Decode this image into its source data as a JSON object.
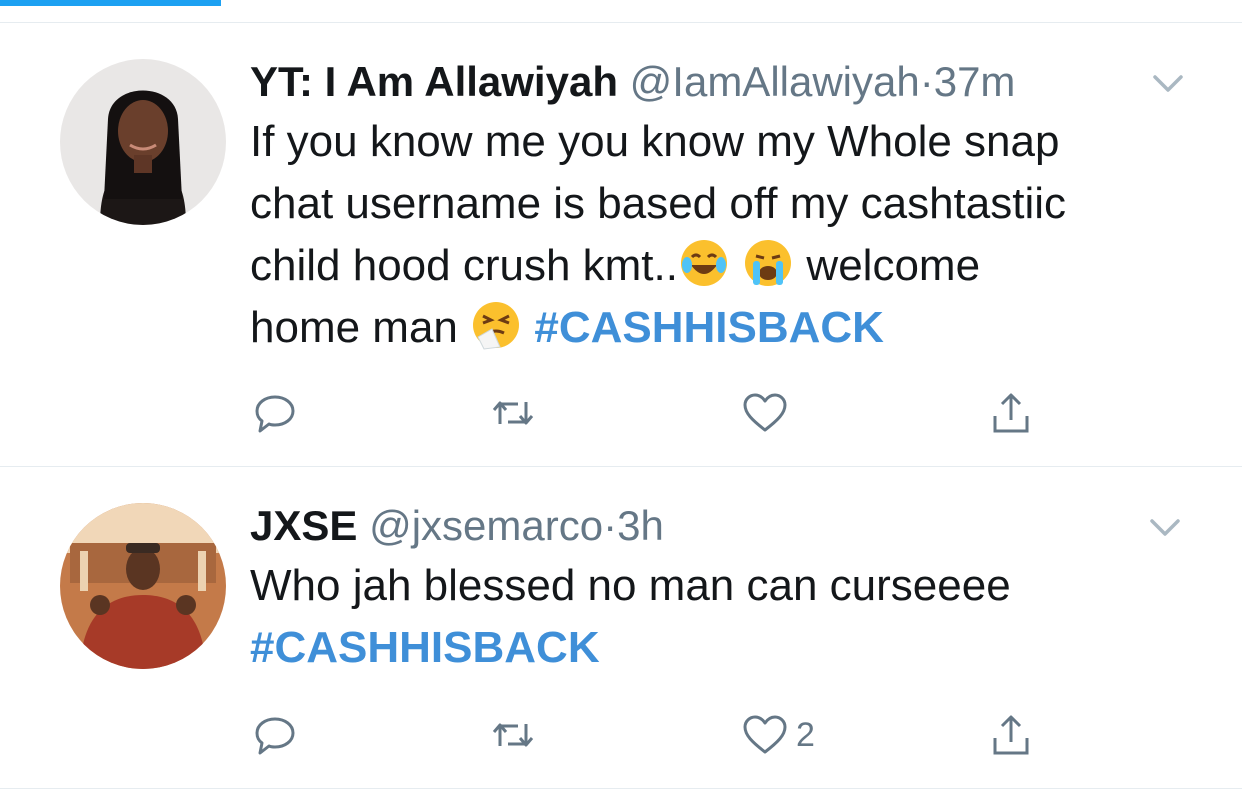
{
  "tweets": [
    {
      "name": "YT: I Am Allawiyah",
      "handle": "@IamAllawiyah",
      "separator": "·",
      "time": "37m",
      "text_line1": "If you know me you know my Whole snap",
      "text_line2": "chat username is based off my cashtastiic",
      "text_line3_a": "child hood crush kmt..",
      "text_line3_b": " welcome",
      "text_line4": "home man ",
      "hashtag": "#CASHHISBACK",
      "emojis": [
        "face-with-tears-of-joy-icon",
        "loudly-crying-face-icon",
        "sneezing-face-icon"
      ],
      "like_count": ""
    },
    {
      "name": "JXSE",
      "handle": "@jxsemarco",
      "separator": "·",
      "time": "3h",
      "text_line1": "Who jah blessed no man can curseeee",
      "hashtag": "#CASHHISBACK",
      "like_count": "2"
    }
  ],
  "colors": {
    "accent": "#1da1f2",
    "hashtag": "#3f8fd8",
    "muted": "#657786",
    "divider": "#e6ecf0"
  },
  "icons": [
    "reply-icon",
    "retweet-icon",
    "like-icon",
    "share-icon",
    "chevron-down-icon"
  ]
}
